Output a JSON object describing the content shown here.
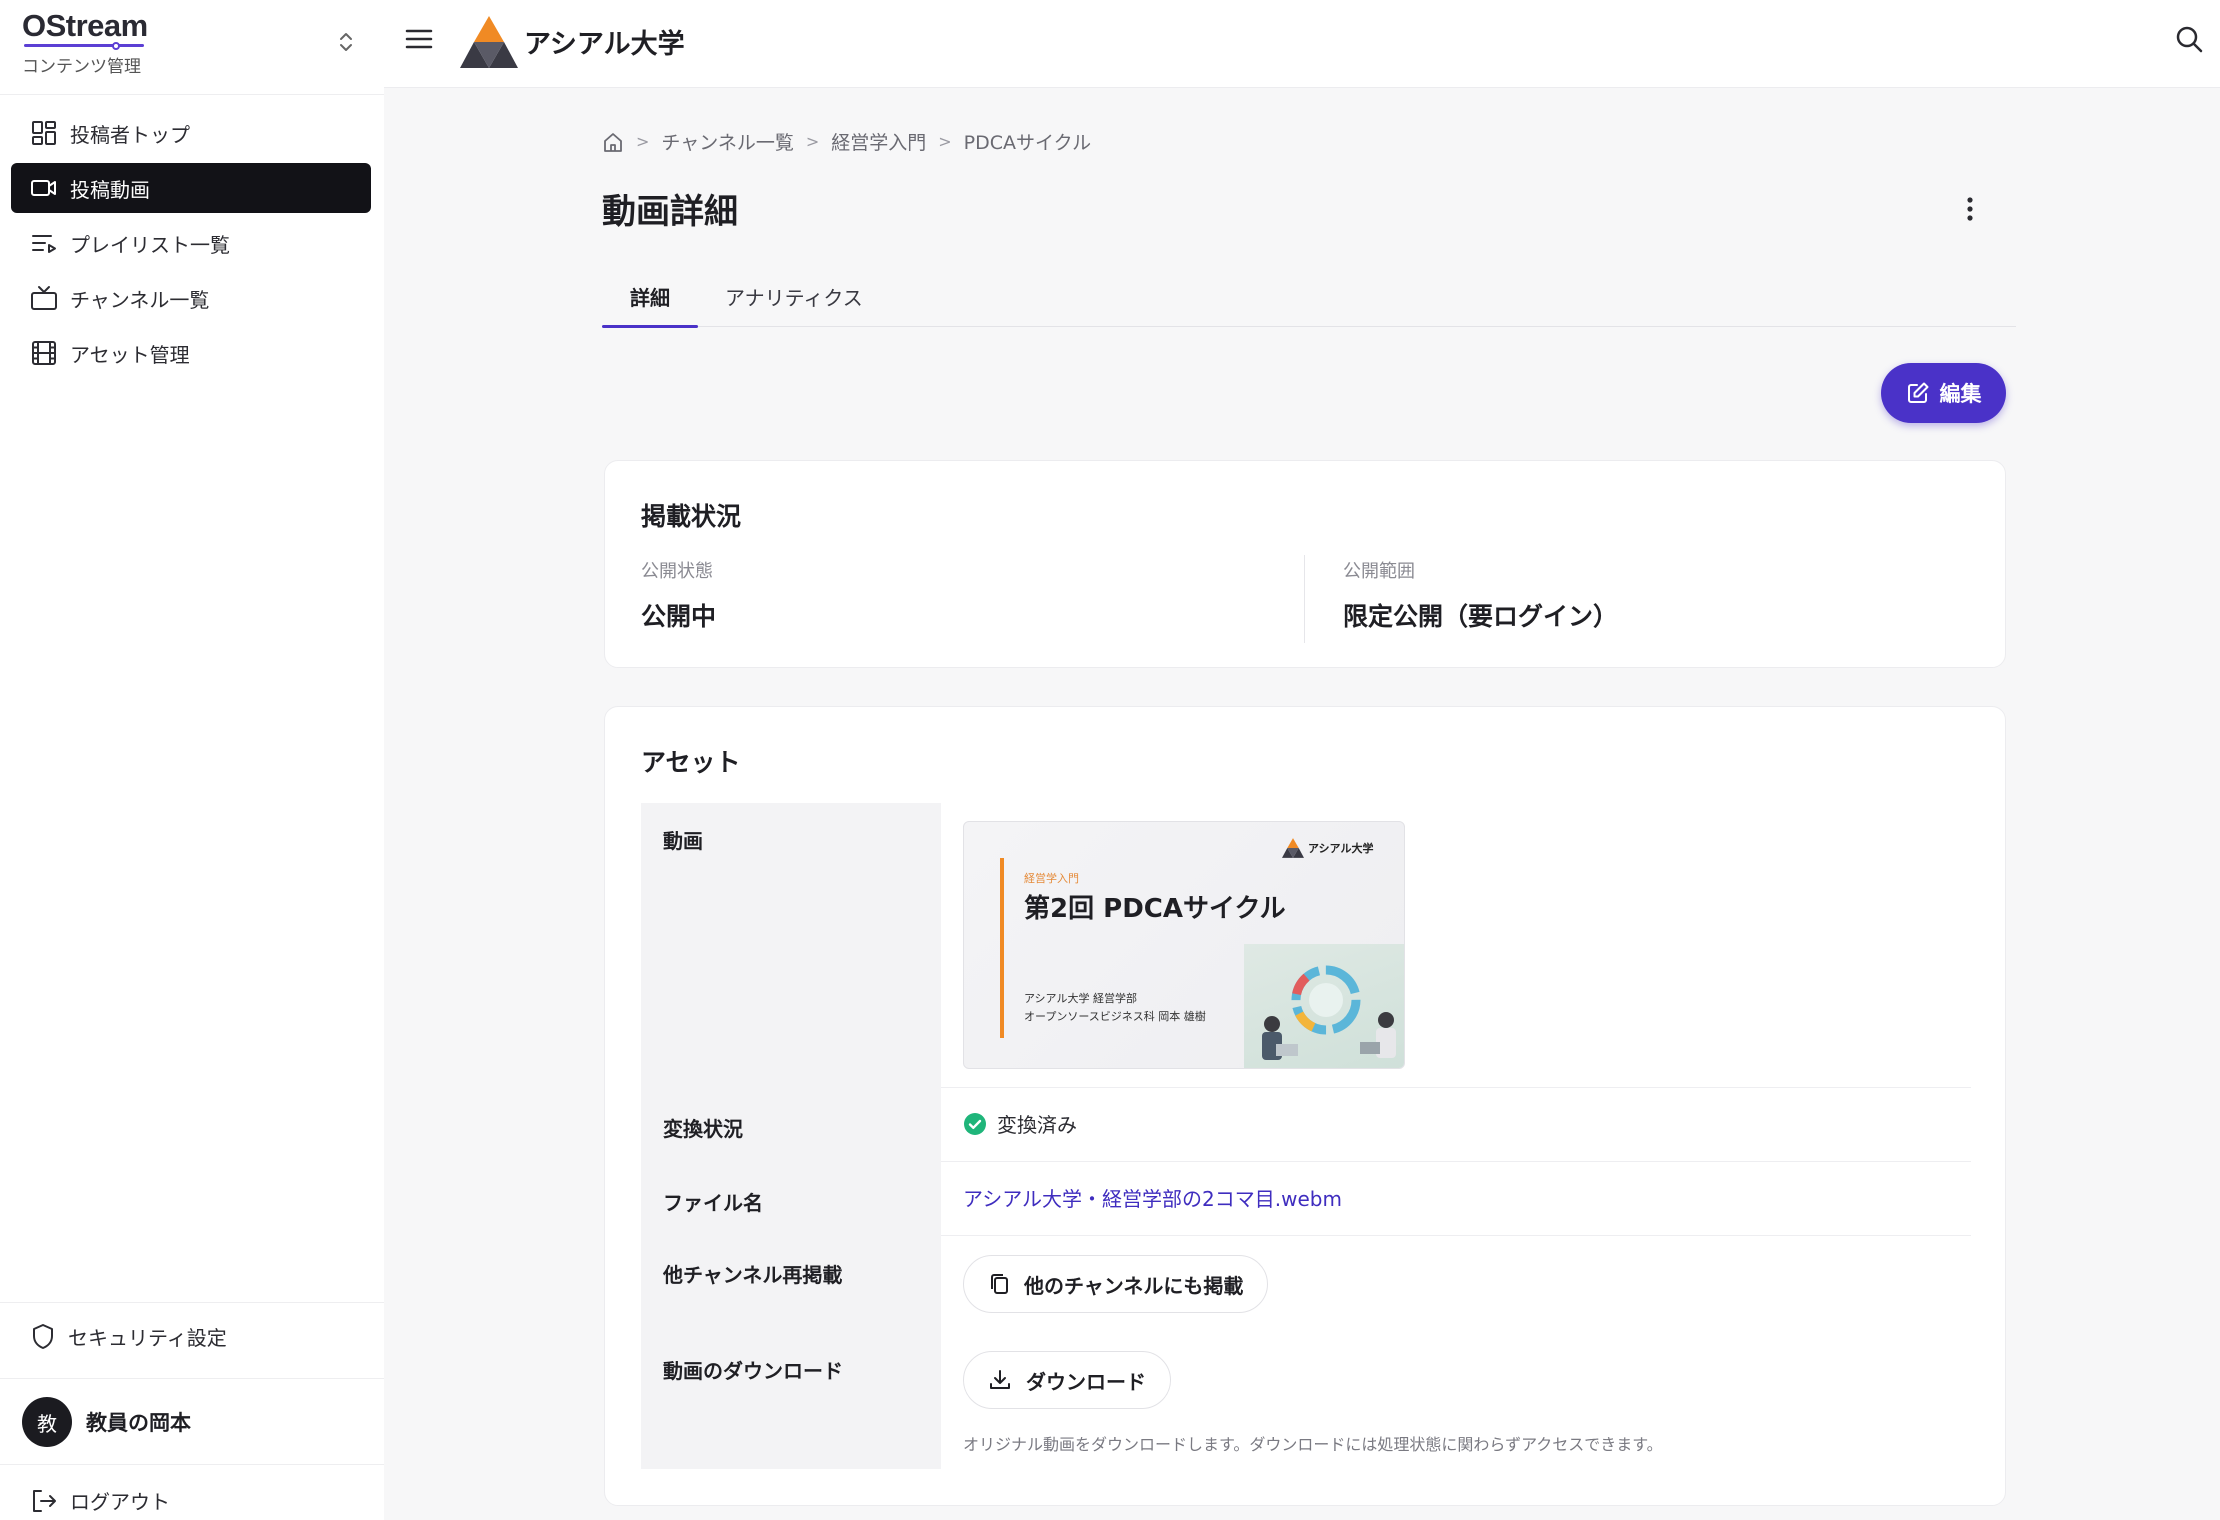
{
  "sidebar": {
    "brand": "OStream",
    "brand_sub": "コンテンツ管理",
    "items": [
      {
        "label": "投稿者トップ",
        "icon": "dashboard-icon"
      },
      {
        "label": "投稿動画",
        "icon": "video-camera-icon",
        "active": true
      },
      {
        "label": "プレイリスト一覧",
        "icon": "playlist-icon"
      },
      {
        "label": "チャンネル一覧",
        "icon": "tv-icon"
      },
      {
        "label": "アセット管理",
        "icon": "film-icon"
      }
    ],
    "security": "セキュリティ設定",
    "user": {
      "initial": "教",
      "name": "教員の岡本"
    },
    "logout": "ログアウト"
  },
  "header": {
    "org_name": "アシアル大学"
  },
  "breadcrumb": {
    "items": [
      "チャンネル一覧",
      "経営学入門",
      "PDCAサイクル"
    ],
    "separator": ">"
  },
  "page": {
    "title": "動画詳細",
    "tabs": [
      "詳細",
      "アナリティクス"
    ],
    "edit_label": "編集"
  },
  "publish": {
    "title": "掲載状況",
    "status_label": "公開状態",
    "status_value": "公開中",
    "scope_label": "公開範囲",
    "scope_value": "限定公開（要ログイン）"
  },
  "assets": {
    "title": "アセット",
    "labels": {
      "video": "動画",
      "conversion": "変換状況",
      "filename": "ファイル名",
      "repost": "他チャンネル再掲載",
      "download": "動画のダウンロード"
    },
    "thumbnail": {
      "course": "経営学入門",
      "title": "第2回 PDCAサイクル",
      "brand": "アシアル大学",
      "meta1": "アシアル大学 経営学部",
      "meta2": "オープンソースビジネス科 岡本 雄樹"
    },
    "conversion_status": "変換済み",
    "filename": "アシアル大学・経営学部の2コマ目.webm",
    "repost_button": "他のチャンネルにも掲載",
    "download_button": "ダウンロード",
    "download_help": "オリジナル動画をダウンロードします。ダウンロードには処理状態に関わらずアクセスできます。"
  },
  "colors": {
    "accent": "#4a32c8",
    "active_nav": "#121217",
    "success": "#1fb57a",
    "logo_orange": "#f08a24",
    "logo_dark": "#3a3a44"
  }
}
